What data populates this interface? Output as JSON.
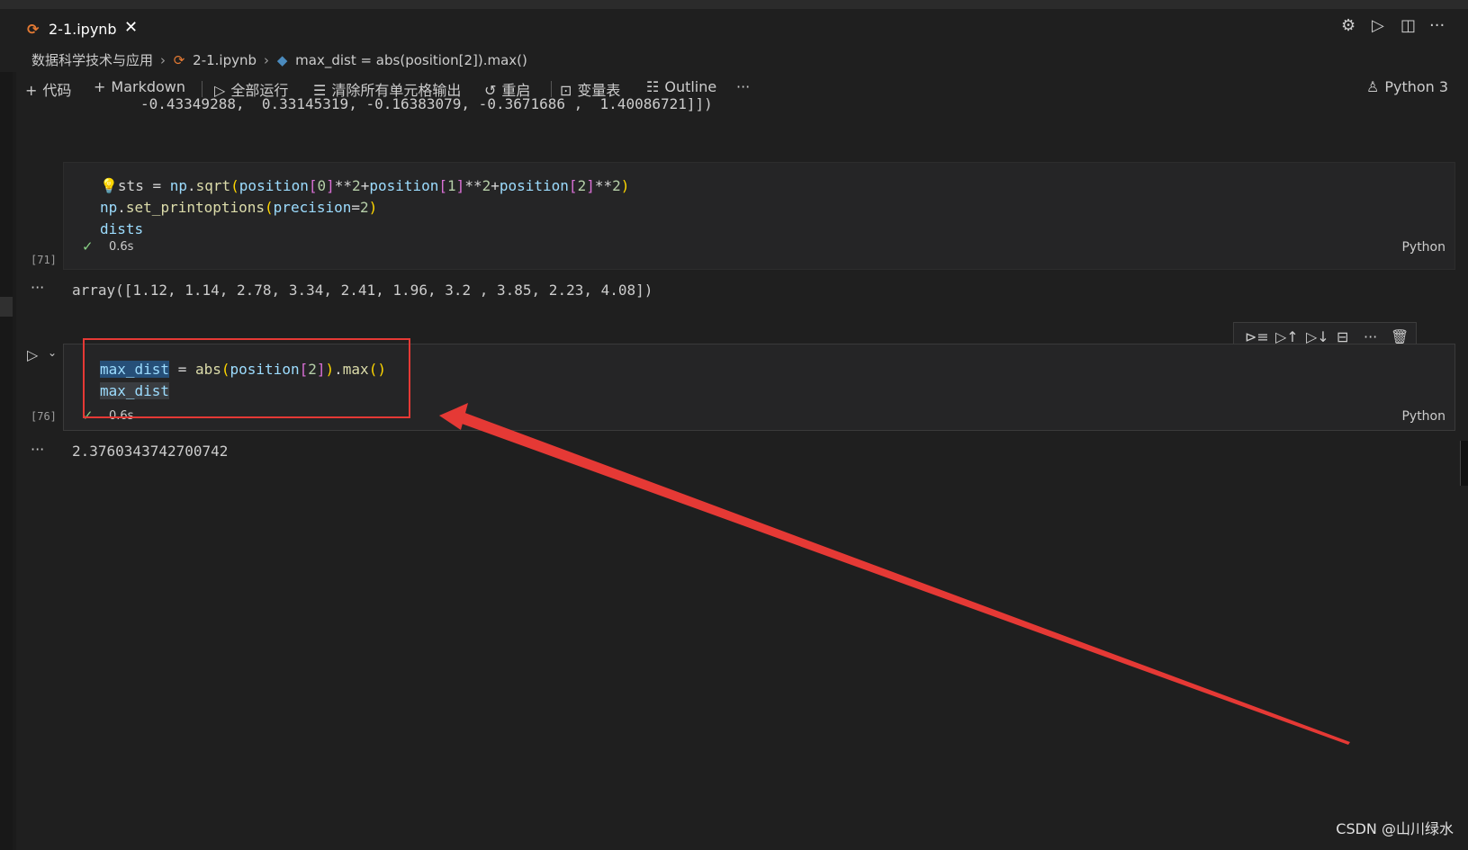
{
  "tab": {
    "icon": "jupyter-icon",
    "title": "2-1.ipynb",
    "close": "✕"
  },
  "breadcrumbs": [
    "数据科学技术与应用",
    "2-1.ipynb",
    "max_dist = abs(position[2]).max()"
  ],
  "toolbar": {
    "add_code": "代码",
    "add_markdown": "Markdown",
    "run_all": "全部运行",
    "clear_outputs": "清除所有单元格输出",
    "restart": "重启",
    "variables": "变量表",
    "outline": "Outline",
    "more": "···",
    "kernel": "Python 3"
  },
  "prev_output_line": "-0.43349288,  0.33145319, -0.16383079, -0.3671686 ,  1.40086721]])",
  "cell1": {
    "exec_count": "[71]",
    "time": "0.6s",
    "language": "Python",
    "output": "array([1.12, 1.14, 2.78, 3.34, 2.41, 1.96, 3.2 , 3.85, 2.23, 4.08])"
  },
  "cell2": {
    "exec_count": "[76]",
    "time": "0.6s",
    "language": "Python",
    "output": "2.3760343742700742"
  },
  "output_ellipsis": "···",
  "watermark": "CSDN @山川绿水",
  "accent_colors": {
    "annotation_red": "#e53935",
    "check_green": "#89d185",
    "jupyter_orange": "#e37933"
  }
}
